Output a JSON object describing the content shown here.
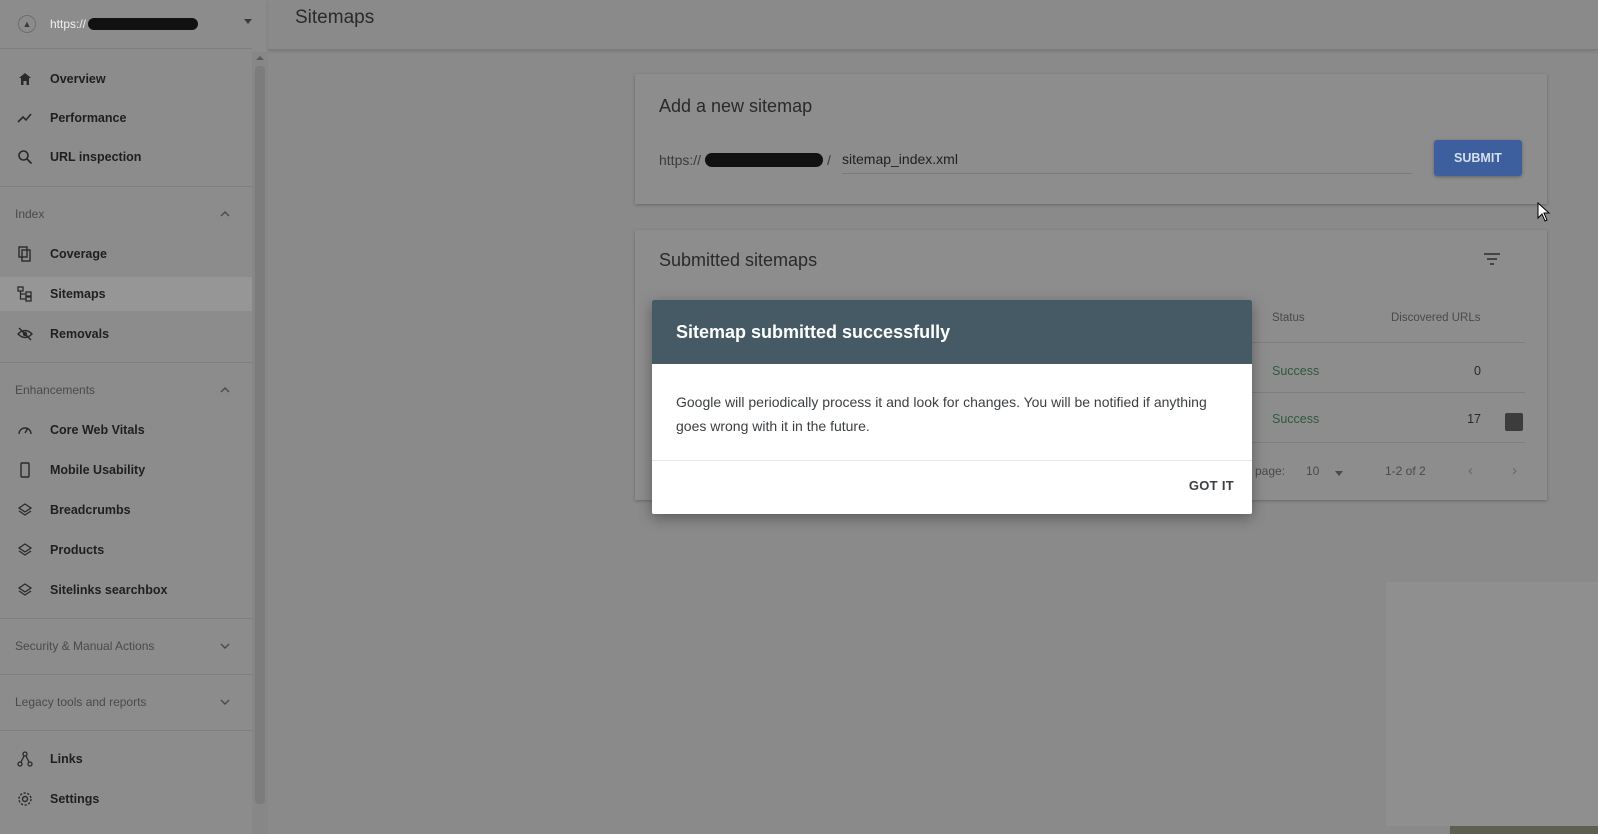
{
  "property": {
    "url_prefix": "https://"
  },
  "sidebar": {
    "items_top": [
      {
        "label": "Overview",
        "icon": "home-icon"
      },
      {
        "label": "Performance",
        "icon": "trending-up-icon"
      },
      {
        "label": "URL inspection",
        "icon": "search-icon"
      }
    ],
    "index_header": "Index",
    "index_items": [
      {
        "label": "Coverage",
        "icon": "file-copy-icon"
      },
      {
        "label": "Sitemaps",
        "icon": "sitemap-icon"
      },
      {
        "label": "Removals",
        "icon": "eye-off-icon"
      }
    ],
    "enh_header": "Enhancements",
    "enh_items": [
      {
        "label": "Core Web Vitals",
        "icon": "gauge-icon"
      },
      {
        "label": "Mobile Usability",
        "icon": "phone-icon"
      },
      {
        "label": "Breadcrumbs",
        "icon": "layers-icon"
      },
      {
        "label": "Products",
        "icon": "layers-icon"
      },
      {
        "label": "Sitelinks searchbox",
        "icon": "layers-icon"
      }
    ],
    "security_header": "Security & Manual Actions",
    "legacy_header": "Legacy tools and reports",
    "bottom_items": [
      {
        "label": "Links",
        "icon": "links-icon"
      },
      {
        "label": "Settings",
        "icon": "gear-icon"
      }
    ]
  },
  "header": {
    "title": "Sitemaps"
  },
  "add_sitemap": {
    "title": "Add a new sitemap",
    "prefix": "https://",
    "prefix_suffix": "/",
    "input_value": "sitemap_index.xml",
    "submit_label": "SUBMIT"
  },
  "submitted": {
    "title": "Submitted sitemaps",
    "columns": {
      "status": "Status",
      "discovered": "Discovered URLs"
    },
    "rows": [
      {
        "status": "Success",
        "discovered": "0"
      },
      {
        "status": "Success",
        "discovered": "17"
      }
    ],
    "pager": {
      "rows_label": "page:",
      "rows_value": "10",
      "range": "1-2 of 2"
    }
  },
  "dialog": {
    "title": "Sitemap submitted successfully",
    "body": "Google will periodically process it and look for changes. You will be notified if anything goes wrong with it in the future.",
    "button": "GOT IT"
  },
  "colors": {
    "dialog_header": "#455a64",
    "submit": "#3d5f9e",
    "success": "#2f5a3c"
  }
}
